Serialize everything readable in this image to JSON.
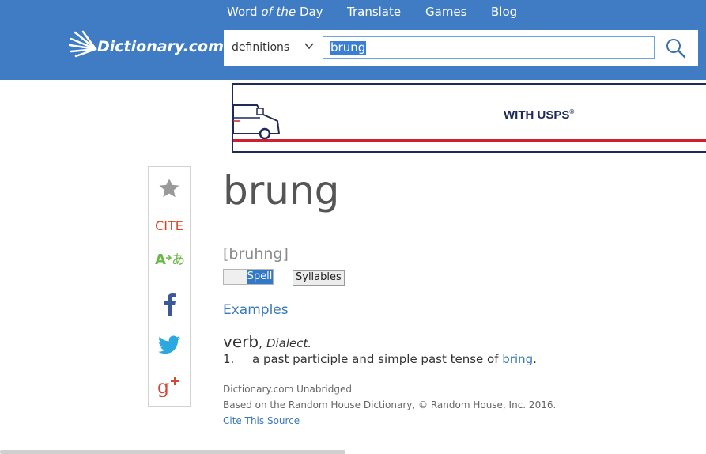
{
  "nav": {
    "items": [
      {
        "pre": "Word ",
        "em": "of the",
        "post": " Day"
      },
      {
        "pre": "Translate",
        "em": "",
        "post": ""
      },
      {
        "pre": "Games",
        "em": "",
        "post": ""
      },
      {
        "pre": "Blog",
        "em": "",
        "post": ""
      }
    ]
  },
  "logo": {
    "text": "Dictionary.com"
  },
  "search": {
    "type": "definitions",
    "query": "brung"
  },
  "ad": {
    "text": "WITH USPS",
    "mark": "®"
  },
  "sidebar": {
    "cite_label": "CITE"
  },
  "entry": {
    "headword": "brung",
    "pronunciation": "[bruhng]",
    "spell_label": "Spell",
    "syllables_label": "Syllables",
    "examples_label": "Examples",
    "pos": "verb",
    "pos_sep": ",",
    "pos_label": "Dialect.",
    "definition": {
      "number": "1.",
      "text": "a past participle and simple past tense of ",
      "link": "bring",
      "end": "."
    }
  },
  "source": {
    "name": "Dictionary.com Unabridged",
    "based_on": "Based on the Random House Dictionary, © Random House, Inc. 2016.",
    "cite_link": "Cite This Source"
  },
  "colors": {
    "header_bg": "#3f7cc3",
    "link": "#3a7ab8",
    "cite": "#e0401d",
    "facebook": "#3b5998",
    "twitter": "#2ca8e0",
    "google_plus": "#d34836",
    "translate": "#6bb844"
  }
}
